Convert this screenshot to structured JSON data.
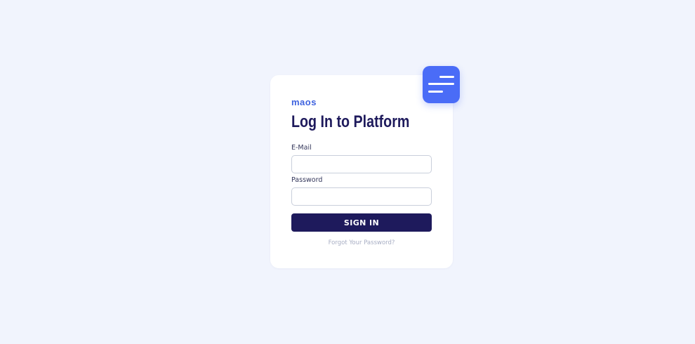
{
  "brand": {
    "name": "maos"
  },
  "login": {
    "title": "Log In to Platform",
    "email_label": "E-Mail",
    "email_value": "",
    "email_placeholder": "",
    "password_label": "Password",
    "password_value": "",
    "password_placeholder": "",
    "submit_label": "SIGN IN",
    "forgot_label": "Forgot Your Password?"
  },
  "menu_button": {
    "icon": "hamburger-menu-icon"
  },
  "colors": {
    "background": "#f1f4fd",
    "card": "#ffffff",
    "accent": "#4a6cf7",
    "brand_text": "#3f63df",
    "primary_dark": "#1e1a5c",
    "muted_link": "#a8aec4"
  }
}
